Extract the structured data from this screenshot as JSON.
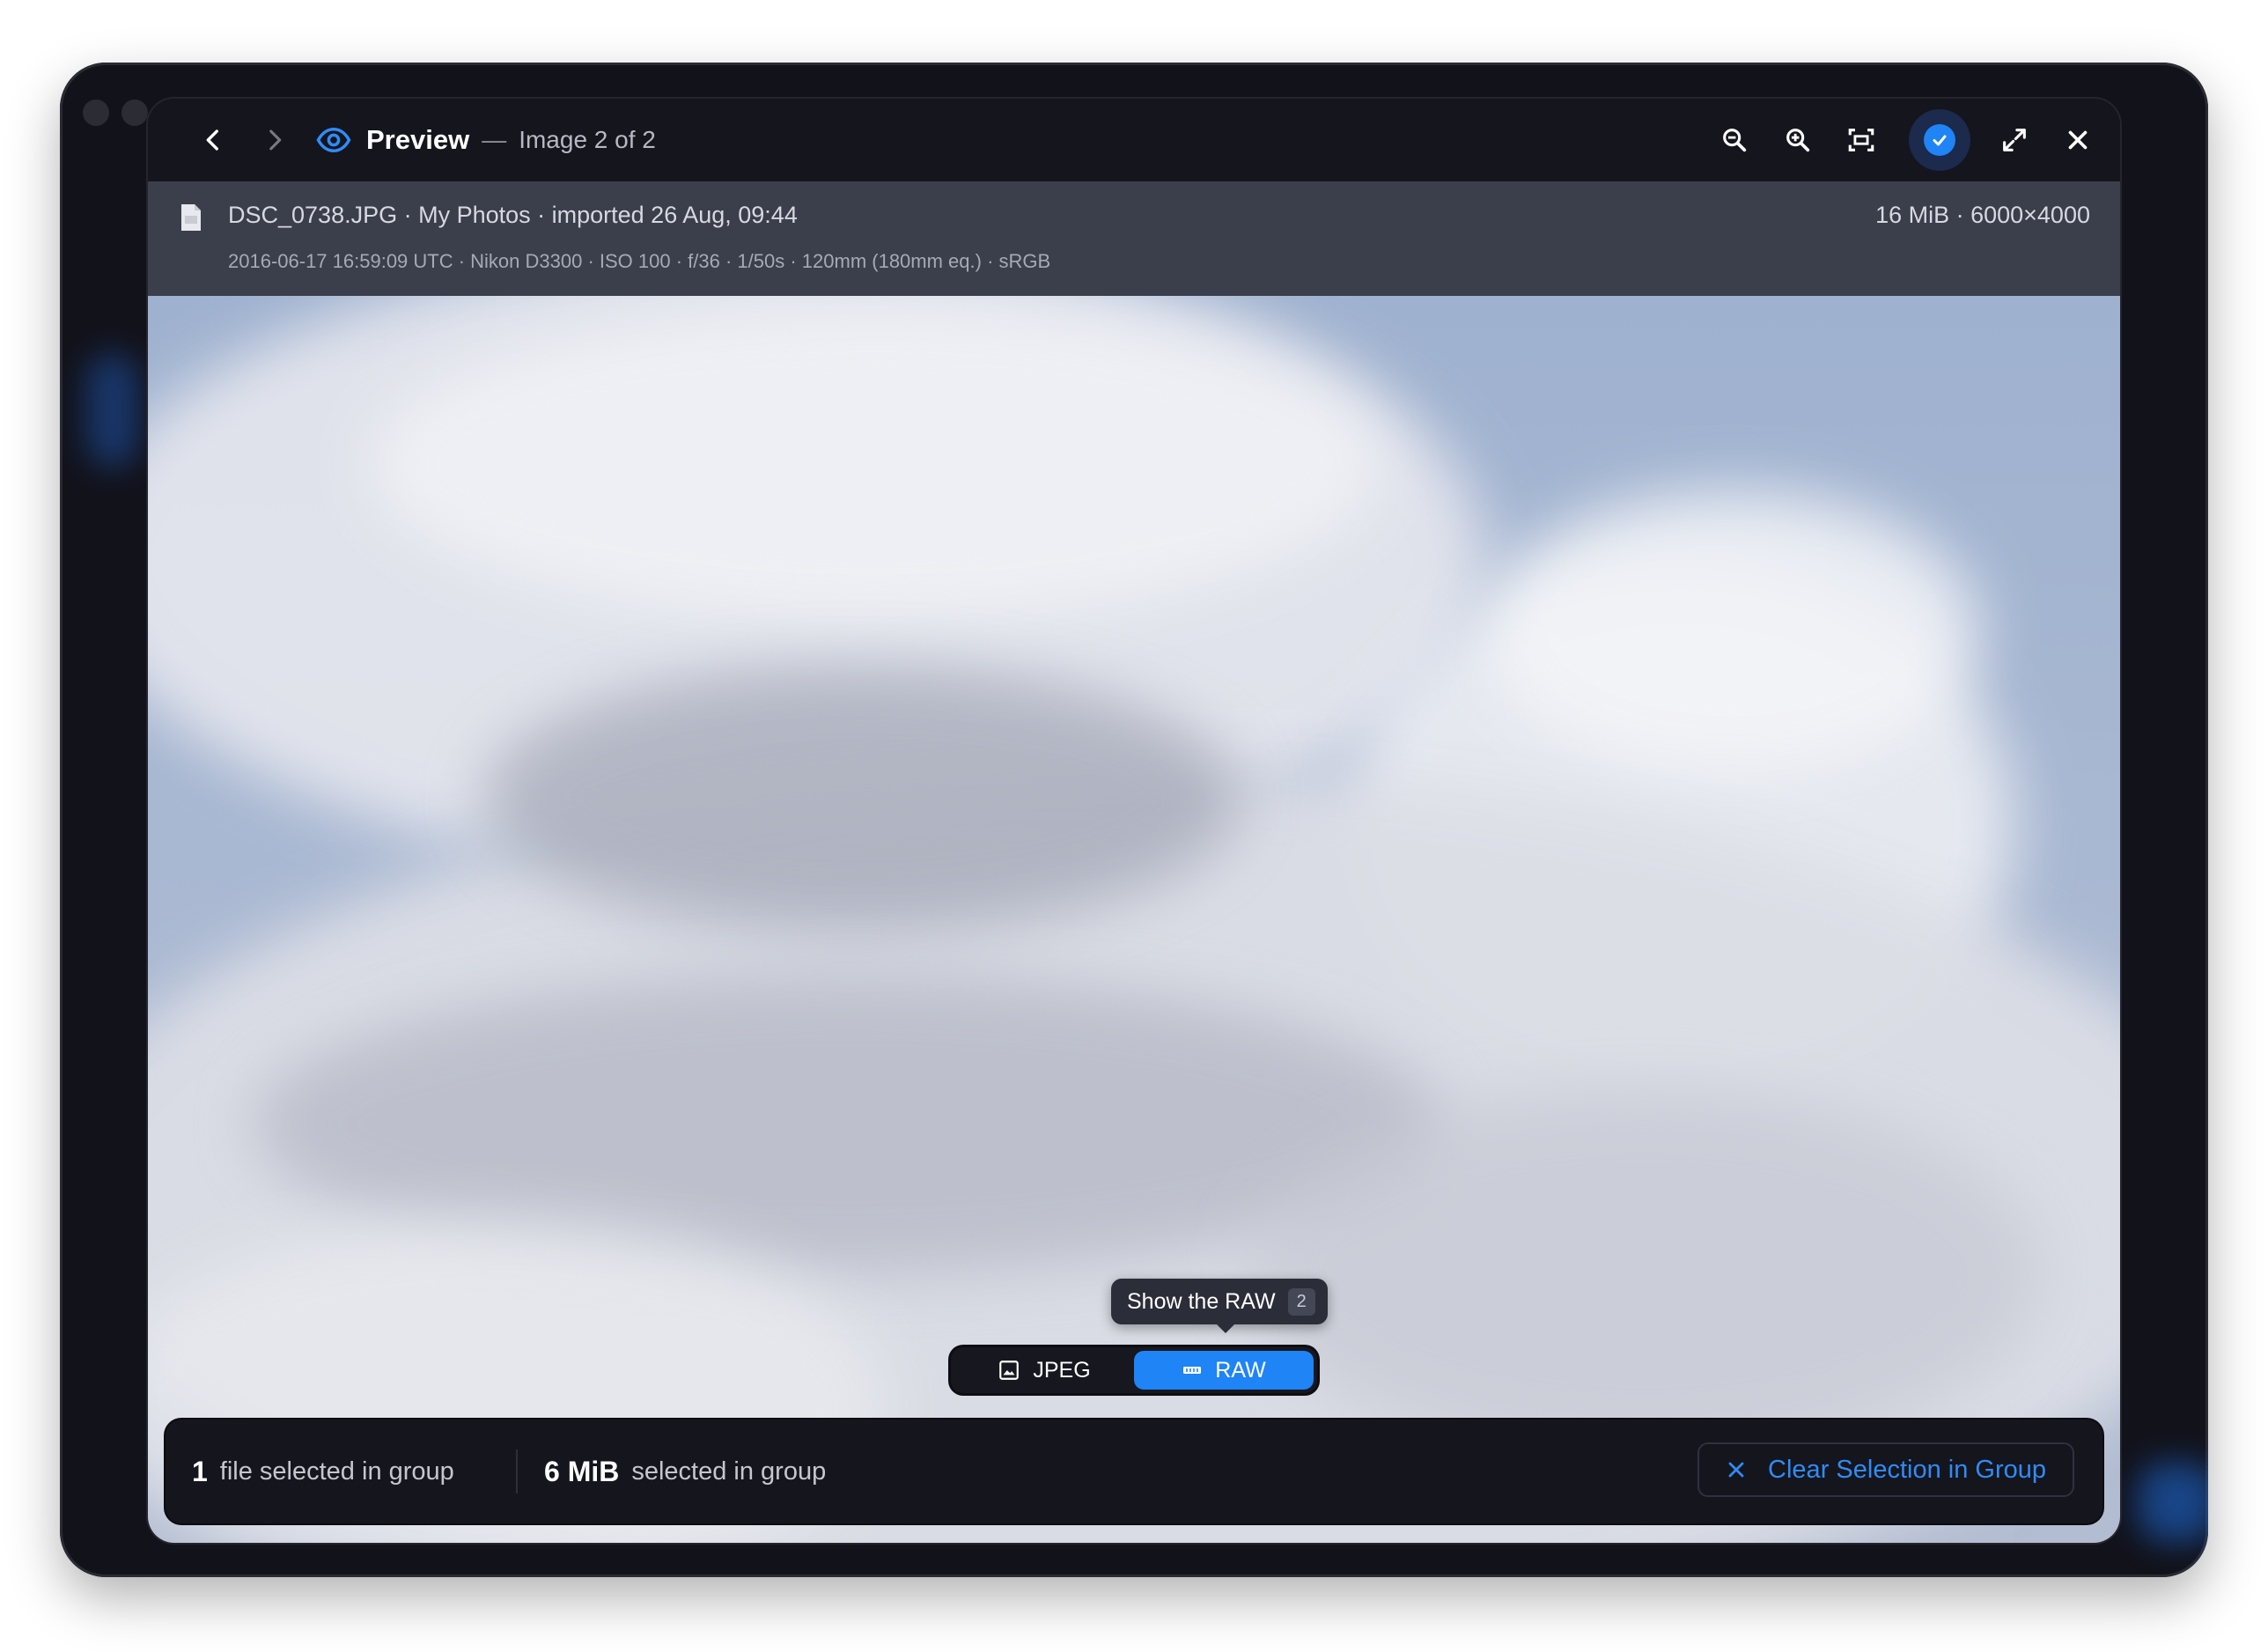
{
  "toolbar": {
    "title": "Preview",
    "separator": "—",
    "subtitle": "Image 2 of 2",
    "icons": {
      "back": "chevron-left-icon",
      "forward": "chevron-right-icon",
      "preview": "eye-icon",
      "zoom_out": "zoom-out-icon",
      "zoom_in": "zoom-in-icon",
      "fit": "fit-to-screen-icon",
      "selected": "check-circle-icon",
      "fullscreen": "expand-icon",
      "close": "close-icon"
    }
  },
  "info": {
    "file_line": "DSC_0738.JPG · My Photos · imported 26 Aug, 09:44",
    "meta_line": "2016-06-17 16:59:09 UTC · Nikon D3300 · ISO 100 · f/36 · 1/50s · 120mm (180mm eq.) · sRGB",
    "size_line": "16 MiB · 6000×4000"
  },
  "tooltip": {
    "text": "Show the RAW",
    "shortcut": "2"
  },
  "format_toggle": {
    "options": [
      {
        "label": "JPEG",
        "icon": "image-icon",
        "selected": false
      },
      {
        "label": "RAW",
        "icon": "raw-icon",
        "selected": true
      }
    ]
  },
  "status": {
    "count": "1",
    "count_label": "file selected in group",
    "size": "6 MiB",
    "size_label": "selected in group",
    "clear_label": "Clear Selection in Group"
  },
  "colors": {
    "accent": "#1f84f5",
    "toolbar_bg": "#15151d",
    "infobar_bg": "#3b3e4b",
    "sky": "#a9b8d2"
  }
}
